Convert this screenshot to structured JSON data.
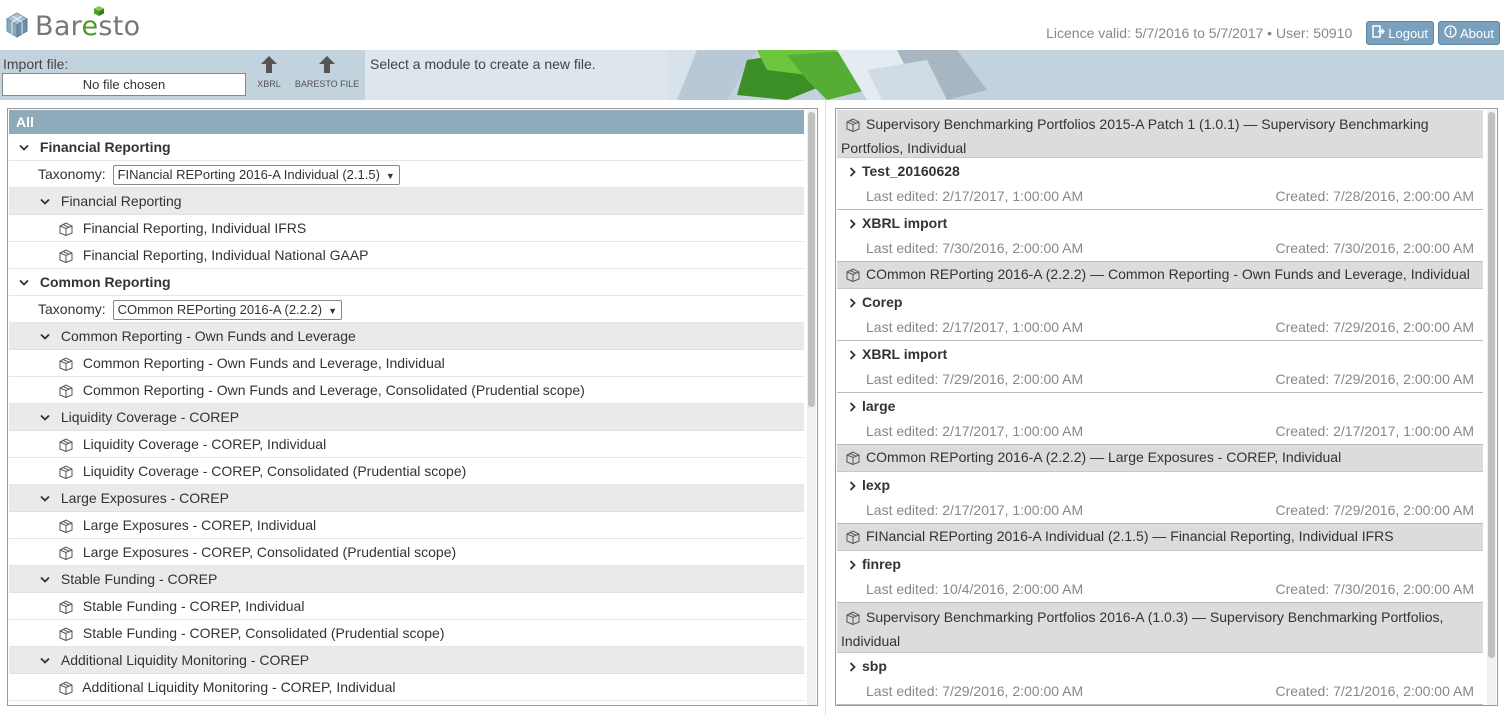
{
  "app": {
    "name_part1": "Bar",
    "name_e": "e",
    "name_part2": "sto"
  },
  "header": {
    "licence": "Licence valid: 5/7/2016 to 5/7/2017  •  User: 50910",
    "logout_label": "Logout",
    "about_label": "About"
  },
  "toolbar": {
    "import_label": "Import file:",
    "file_input_value": "No file chosen",
    "xbrl_label": "XBRL",
    "baresto_file_label": "BARESTO FILE",
    "message": "Select a module to create a new file."
  },
  "left": {
    "all_label": "All",
    "taxonomy_label": "Taxonomy:",
    "sections": [
      {
        "title": "Financial Reporting",
        "taxonomy": "FINancial REPorting 2016-A Individual (2.1.5)",
        "groups": [
          {
            "title": "Financial Reporting",
            "modules": [
              "Financial Reporting, Individual IFRS",
              "Financial Reporting, Individual National GAAP"
            ]
          }
        ]
      },
      {
        "title": "Common Reporting",
        "taxonomy": "COmmon REPorting 2016-A (2.2.2)",
        "groups": [
          {
            "title": "Common Reporting - Own Funds and Leverage",
            "modules": [
              "Common Reporting - Own Funds and Leverage, Individual",
              "Common Reporting - Own Funds and Leverage, Consolidated (Prudential scope)"
            ]
          },
          {
            "title": "Liquidity Coverage - COREP",
            "modules": [
              "Liquidity Coverage - COREP, Individual",
              "Liquidity Coverage - COREP, Consolidated (Prudential scope)"
            ]
          },
          {
            "title": "Large Exposures - COREP",
            "modules": [
              "Large Exposures - COREP, Individual",
              "Large Exposures - COREP, Consolidated (Prudential scope)"
            ]
          },
          {
            "title": "Stable Funding - COREP",
            "modules": [
              "Stable Funding - COREP, Individual",
              "Stable Funding - COREP, Consolidated (Prudential scope)"
            ]
          },
          {
            "title": "Additional Liquidity Monitoring - COREP",
            "modules": [
              "Additional Liquidity Monitoring - COREP, Individual"
            ]
          }
        ]
      }
    ]
  },
  "right": {
    "groups": [
      {
        "title": "Supervisory Benchmarking Portfolios 2015-A Patch 1 (1.0.1) — Supervisory Benchmarking Portfolios, Individual",
        "files": [
          {
            "name": "Test_20160628",
            "edited": "Last edited: 2/17/2017, 1:00:00 AM",
            "created": "Created: 7/28/2016, 2:00:00 AM"
          },
          {
            "name": "XBRL import",
            "edited": "Last edited: 7/30/2016, 2:00:00 AM",
            "created": "Created: 7/30/2016, 2:00:00 AM"
          }
        ]
      },
      {
        "title": "COmmon REPorting 2016-A (2.2.2) — Common Reporting - Own Funds and Leverage, Individual",
        "files": [
          {
            "name": "Corep",
            "edited": "Last edited: 2/17/2017, 1:00:00 AM",
            "created": "Created: 7/29/2016, 2:00:00 AM"
          },
          {
            "name": "XBRL import",
            "edited": "Last edited: 7/29/2016, 2:00:00 AM",
            "created": "Created: 7/29/2016, 2:00:00 AM"
          },
          {
            "name": "large",
            "edited": "Last edited: 2/17/2017, 1:00:00 AM",
            "created": "Created: 2/17/2017, 1:00:00 AM"
          }
        ]
      },
      {
        "title": "COmmon REPorting 2016-A (2.2.2) — Large Exposures - COREP, Individual",
        "files": [
          {
            "name": "lexp",
            "edited": "Last edited: 2/17/2017, 1:00:00 AM",
            "created": "Created: 7/29/2016, 2:00:00 AM"
          }
        ]
      },
      {
        "title": "FINancial REPorting 2016-A Individual (2.1.5) — Financial Reporting, Individual IFRS",
        "files": [
          {
            "name": "finrep",
            "edited": "Last edited: 10/4/2016, 2:00:00 AM",
            "created": "Created: 7/30/2016, 2:00:00 AM"
          }
        ]
      },
      {
        "title": "Supervisory Benchmarking Portfolios 2016-A (1.0.3) — Supervisory Benchmarking Portfolios, Individual",
        "files": [
          {
            "name": "sbp",
            "edited": "Last edited: 7/29/2016, 2:00:00 AM",
            "created": "Created: 7/21/2016, 2:00:00 AM"
          }
        ]
      }
    ]
  },
  "colors": {
    "accent": "#7aa0bc",
    "toolbar": "#c3d3de",
    "all_header": "#8eaabb",
    "logo_green": "#4a9a2e"
  },
  "icons": [
    "logo-cube-icon",
    "logout-icon",
    "info-icon",
    "upload-arrow-icon",
    "chevron-down-icon",
    "chevron-right-icon",
    "module-cube-icon"
  ]
}
